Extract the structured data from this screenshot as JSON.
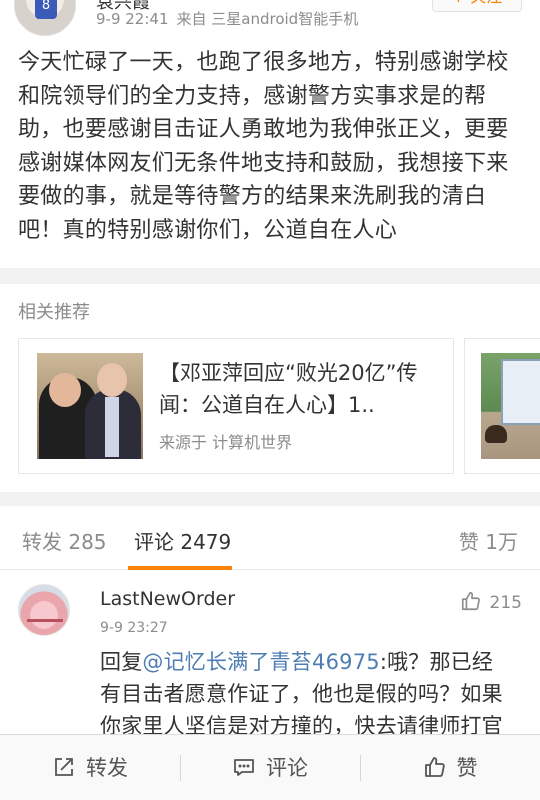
{
  "post": {
    "author": "袁兴霞",
    "time": "9-9 22:41",
    "source": "来自 三星android智能手机",
    "follow_label": "+ 关注",
    "body": "今天忙碌了一天，也跑了很多地方，特别感谢学校和院领导们的全力支持，感谢警方实事求是的帮助，也要感谢目击证人勇敢地为我伸张正义，更要感谢媒体网友们无条件地支持和鼓励，我想接下来要做的事，就是等待警方的结果来洗刷我的清白吧！真的特别感谢你们，公道自在人心"
  },
  "related": {
    "title": "相关推荐",
    "card": {
      "title": "【邓亚萍回应“败光20亿”传闻：公道自在人心】1..",
      "source": "来源于 计算机世界"
    }
  },
  "tabs": {
    "repost": "转发 285",
    "comment": "评论 2479",
    "like": "赞 1万"
  },
  "comment": {
    "name": "LastNewOrder",
    "time": "9-9 23:27",
    "likes": "215",
    "prefix": "回复",
    "mention": "@记忆长满了青苔46975",
    "text": ":哦？那已经有目击者愿意作证了，他也是假的吗？如果你家里人坚信是对方撞的，快去请律师打官司，不然不要逼逼，硬上走让更多"
  },
  "toolbar": {
    "repost": "转发",
    "comment": "评论",
    "like": "赞"
  },
  "colors": {
    "accent": "#ff8200",
    "link": "#4f7db3"
  }
}
